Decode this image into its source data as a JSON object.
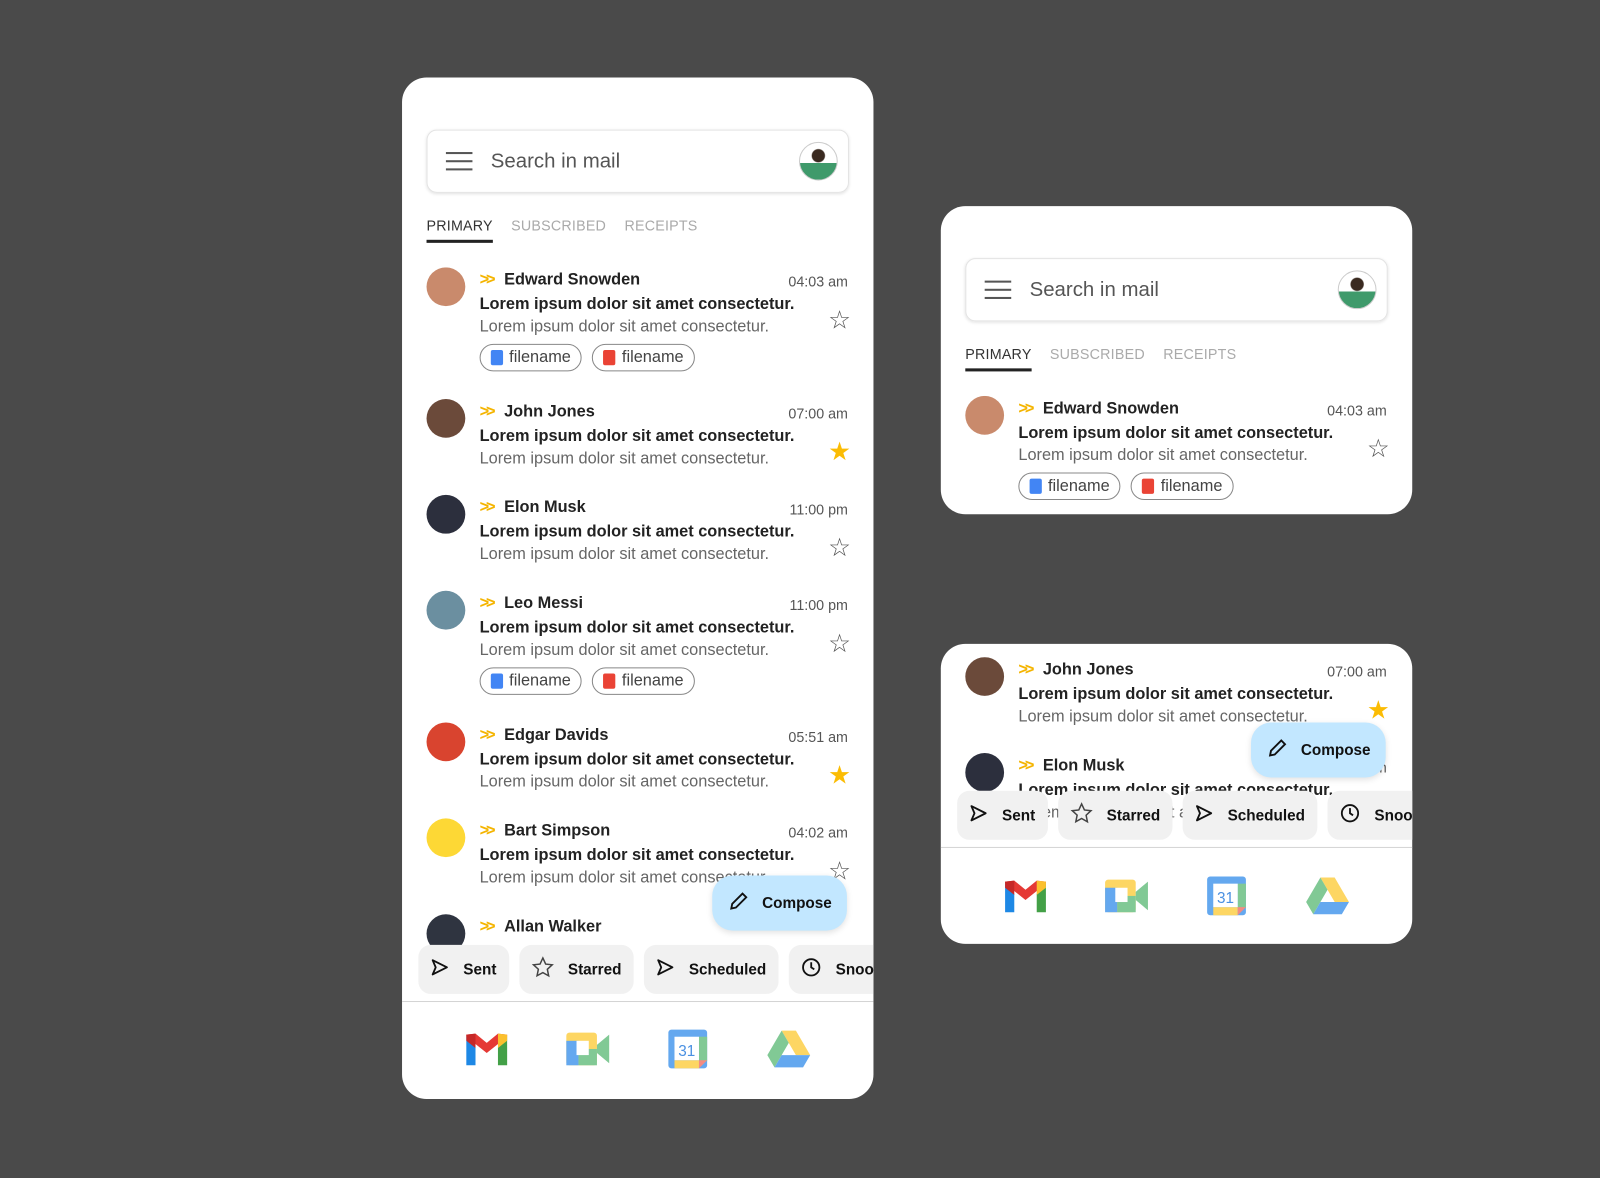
{
  "search": {
    "placeholder": "Search in mail"
  },
  "tabs": [
    {
      "label": "PRIMARY",
      "active": true
    },
    {
      "label": "SUBSCRIBED"
    },
    {
      "label": "RECEIPTS"
    }
  ],
  "colors": {
    "accent": "#f4b400",
    "star_on": "#fbbc04",
    "compose_bg": "#c2e7ff",
    "file_blue": "#4285f4",
    "file_red": "#ea4335"
  },
  "emails": [
    {
      "sender": "Edward Snowden",
      "time": "04:03 am",
      "line1": "Lorem ipsum dolor sit amet consectetur.",
      "line2": "Lorem ipsum dolor sit amet consectetur.",
      "starred": false,
      "avatar": "#c98a6c",
      "attachments": [
        {
          "name": "filename",
          "icon": "doc-blue"
        },
        {
          "name": "filename",
          "icon": "doc-red"
        }
      ]
    },
    {
      "sender": "John Jones",
      "time": "07:00 am",
      "line1": "Lorem ipsum dolor sit amet consectetur.",
      "line2": "Lorem ipsum dolor sit amet consectetur.",
      "starred": true,
      "avatar": "#6b4a3a",
      "attachments": []
    },
    {
      "sender": "Elon Musk",
      "time": "11:00 pm",
      "line1": "Lorem ipsum dolor sit amet consectetur.",
      "line2": "Lorem ipsum dolor sit amet consectetur.",
      "starred": false,
      "avatar": "#2c2f3d",
      "attachments": []
    },
    {
      "sender": "Leo Messi",
      "time": "11:00 pm",
      "line1": "Lorem ipsum dolor sit amet consectetur.",
      "line2": "Lorem ipsum dolor sit amet consectetur.",
      "starred": false,
      "avatar": "#6b8fa0",
      "attachments": [
        {
          "name": "filename",
          "icon": "doc-blue"
        },
        {
          "name": "filename",
          "icon": "doc-red"
        }
      ]
    },
    {
      "sender": "Edgar Davids",
      "time": "05:51 am",
      "line1": "Lorem ipsum dolor sit amet consectetur.",
      "line2": "Lorem ipsum dolor sit amet consectetur.",
      "starred": true,
      "avatar": "#d9442f",
      "attachments": []
    },
    {
      "sender": "Bart Simpson",
      "time": "04:02 am",
      "line1": "Lorem ipsum dolor sit amet consectetur.",
      "line2": "Lorem ipsum dolor sit amet consectetur.",
      "starred": false,
      "avatar": "#fdd835",
      "attachments": []
    },
    {
      "sender": "Allan Walker",
      "time": "",
      "line1": "",
      "line2": "",
      "starred": false,
      "avatar": "#2f3440",
      "attachments": []
    }
  ],
  "compose": {
    "label": "Compose",
    "icon": "pencil-icon"
  },
  "chips": [
    {
      "label": "Sent",
      "icon": "send-icon"
    },
    {
      "label": "Starred",
      "icon": "star-icon"
    },
    {
      "label": "Scheduled",
      "icon": "scheduled-send-icon"
    },
    {
      "label": "Snooze",
      "icon": "clock-icon"
    }
  ],
  "apps": [
    "gmail",
    "meet",
    "calendar",
    "drive"
  ],
  "calendar_day": "31"
}
